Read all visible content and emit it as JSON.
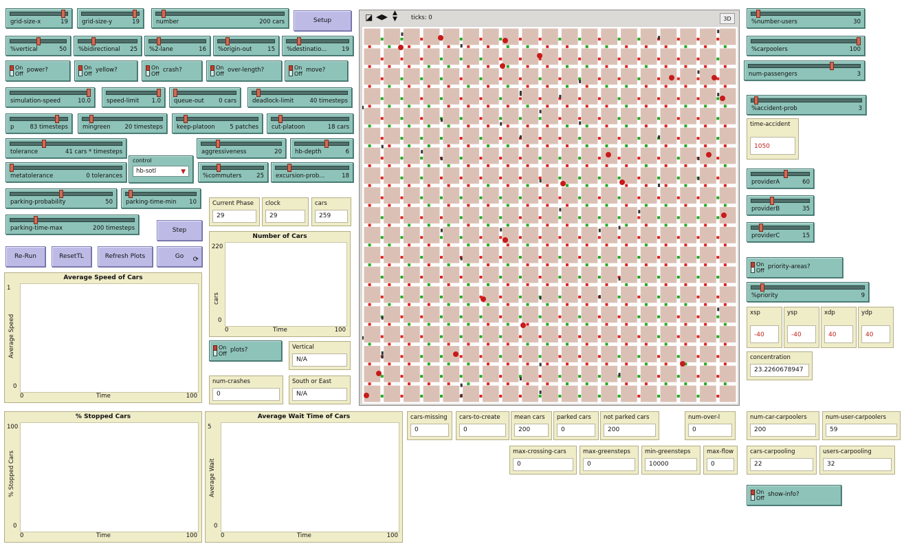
{
  "buttons": {
    "setup": "Setup",
    "step": "Step",
    "rerun": "Re-Run",
    "resettl": "ResetTL",
    "refresh": "Refresh Plots",
    "go": "Go"
  },
  "sliders": [
    {
      "label": "grid-size-x",
      "value": "19",
      "level": 0.95
    },
    {
      "label": "grid-size-y",
      "value": "19",
      "level": 0.95
    },
    {
      "label": "number",
      "value": "200 cars",
      "level": 0.05
    },
    {
      "label": "%vertical",
      "value": "50",
      "level": 0.5
    },
    {
      "label": "%bidirectional",
      "value": "25",
      "level": 0.25
    },
    {
      "label": "%2-lane",
      "value": "16",
      "level": 0.16
    },
    {
      "label": "%origin-out",
      "value": "15",
      "level": 0.15
    },
    {
      "label": "%destinatio...",
      "value": "19",
      "level": 0.19
    },
    {
      "label": "simulation-speed",
      "value": "10.0",
      "level": 1.0
    },
    {
      "label": "speed-limit",
      "value": "1.0",
      "level": 1.0
    },
    {
      "label": "queue-out",
      "value": "0 cars",
      "level": 0.0
    },
    {
      "label": "deadlock-limit",
      "value": "40 timesteps",
      "level": 0.05
    },
    {
      "label": "p",
      "value": "83 timesteps",
      "level": 0.83
    },
    {
      "label": "mingreen",
      "value": "20 timesteps",
      "level": 0.1
    },
    {
      "label": "keep-platoon",
      "value": "5 patches",
      "level": 0.1
    },
    {
      "label": "cut-platoon",
      "value": "18 cars",
      "level": 0.1
    },
    {
      "label": "tolerance",
      "value": "41 cars * timesteps",
      "level": 0.3
    },
    {
      "label": "aggressiveness",
      "value": "20",
      "level": 0.2
    },
    {
      "label": "hb-depth",
      "value": "6",
      "level": 0.6
    },
    {
      "label": "metatolerance",
      "value": "0 tolerances",
      "level": 0.0
    },
    {
      "label": "%commuters",
      "value": "25",
      "level": 0.25
    },
    {
      "label": "excursion-prob...",
      "value": "18",
      "level": 0.18
    },
    {
      "label": "parking-probability",
      "value": "50",
      "level": 0.5
    },
    {
      "label": "parking-time-min",
      "value": "10",
      "level": 0.05
    },
    {
      "label": "parking-time-max",
      "value": "200 timesteps",
      "level": 0.2
    },
    {
      "label": "%number-users",
      "value": "30",
      "level": 0.05
    },
    {
      "label": "%carpoolers",
      "value": "100",
      "level": 1.0
    },
    {
      "label": "num-passengers",
      "value": "3",
      "level": 0.75
    },
    {
      "label": "%accident-prob",
      "value": "3",
      "level": 0.03
    },
    {
      "label": "providerA",
      "value": "60",
      "level": 0.6
    },
    {
      "label": "providerB",
      "value": "35",
      "level": 0.35
    },
    {
      "label": "providerC",
      "value": "15",
      "level": 0.15
    },
    {
      "label": "%priority",
      "value": "9",
      "level": 0.09
    }
  ],
  "switches": [
    {
      "label": "power?",
      "on": "On",
      "off": "Off"
    },
    {
      "label": "yellow?",
      "on": "On",
      "off": "Off"
    },
    {
      "label": "crash?",
      "on": "On",
      "off": "Off"
    },
    {
      "label": "over-length?",
      "on": "On",
      "off": "Off"
    },
    {
      "label": "move?",
      "on": "On",
      "off": "Off"
    },
    {
      "label": "plots?",
      "on": "On",
      "off": "Off"
    },
    {
      "label": "priority-areas?",
      "on": "On",
      "off": "Off"
    },
    {
      "label": "show-info?",
      "on": "On",
      "off": "Off"
    }
  ],
  "chooser": {
    "label": "control",
    "value": "hb-sotl"
  },
  "monitors": [
    {
      "label": "Current Phase",
      "value": "29"
    },
    {
      "label": "clock",
      "value": "29"
    },
    {
      "label": "cars",
      "value": "259"
    },
    {
      "label": "Vertical",
      "value": "N/A"
    },
    {
      "label": "num-crashes",
      "value": "0"
    },
    {
      "label": "South or East",
      "value": "N/A"
    },
    {
      "label": "cars-missing",
      "value": "0"
    },
    {
      "label": "cars-to-create",
      "value": "0"
    },
    {
      "label": "mean cars",
      "value": "200"
    },
    {
      "label": "parked cars",
      "value": "0"
    },
    {
      "label": "not parked cars",
      "value": "200"
    },
    {
      "label": "num-over-l",
      "value": "0"
    },
    {
      "label": "max-crossing-cars",
      "value": "0"
    },
    {
      "label": "max-greensteps",
      "value": "0"
    },
    {
      "label": "min-greensteps",
      "value": "10000"
    },
    {
      "label": "max-flow",
      "value": "0"
    },
    {
      "label": "num-car-carpoolers",
      "value": "200"
    },
    {
      "label": "num-user-carpoolers",
      "value": "59"
    },
    {
      "label": "cars-carpooling",
      "value": "22"
    },
    {
      "label": "users-carpooling",
      "value": "32"
    },
    {
      "label": "concentration",
      "value": "23.2260678947"
    }
  ],
  "inputs": [
    {
      "label": "time-accident",
      "value": "1050"
    },
    {
      "label": "xsp",
      "value": "-40"
    },
    {
      "label": "ysp",
      "value": "-40"
    },
    {
      "label": "xdp",
      "value": "40"
    },
    {
      "label": "ydp",
      "value": "40"
    }
  ],
  "plots": [
    {
      "title": "Number of Cars",
      "ylabel": "cars",
      "xlabel": "Time",
      "ymax": "220",
      "ymin": "0",
      "xmin": "0",
      "xmax": "100"
    },
    {
      "title": "Average Speed of Cars",
      "ylabel": "Average Speed",
      "xlabel": "Time",
      "ymax": "1",
      "ymin": "0",
      "xmin": "0",
      "xmax": "100"
    },
    {
      "title": "% Stopped Cars",
      "ylabel": "% Stopped Cars",
      "xlabel": "Time",
      "ymax": "100",
      "ymin": "0",
      "xmin": "0",
      "xmax": "100"
    },
    {
      "title": "Average Wait Time of Cars",
      "ylabel": "Average Wait",
      "xlabel": "Time",
      "ymax": "5",
      "ymin": "0",
      "xmin": "0",
      "xmax": "100"
    }
  ],
  "view": {
    "ticks": "ticks: 0",
    "three_d": "3D"
  },
  "colors": {
    "slider": "#8ec3b9",
    "button": "#bdbbe6",
    "monitor": "#efecc8",
    "patch": "#dbc1b5",
    "road": "#ffffff",
    "light_red": "#dd2222",
    "light_green": "#22aa22",
    "car": "#c81a1a"
  }
}
